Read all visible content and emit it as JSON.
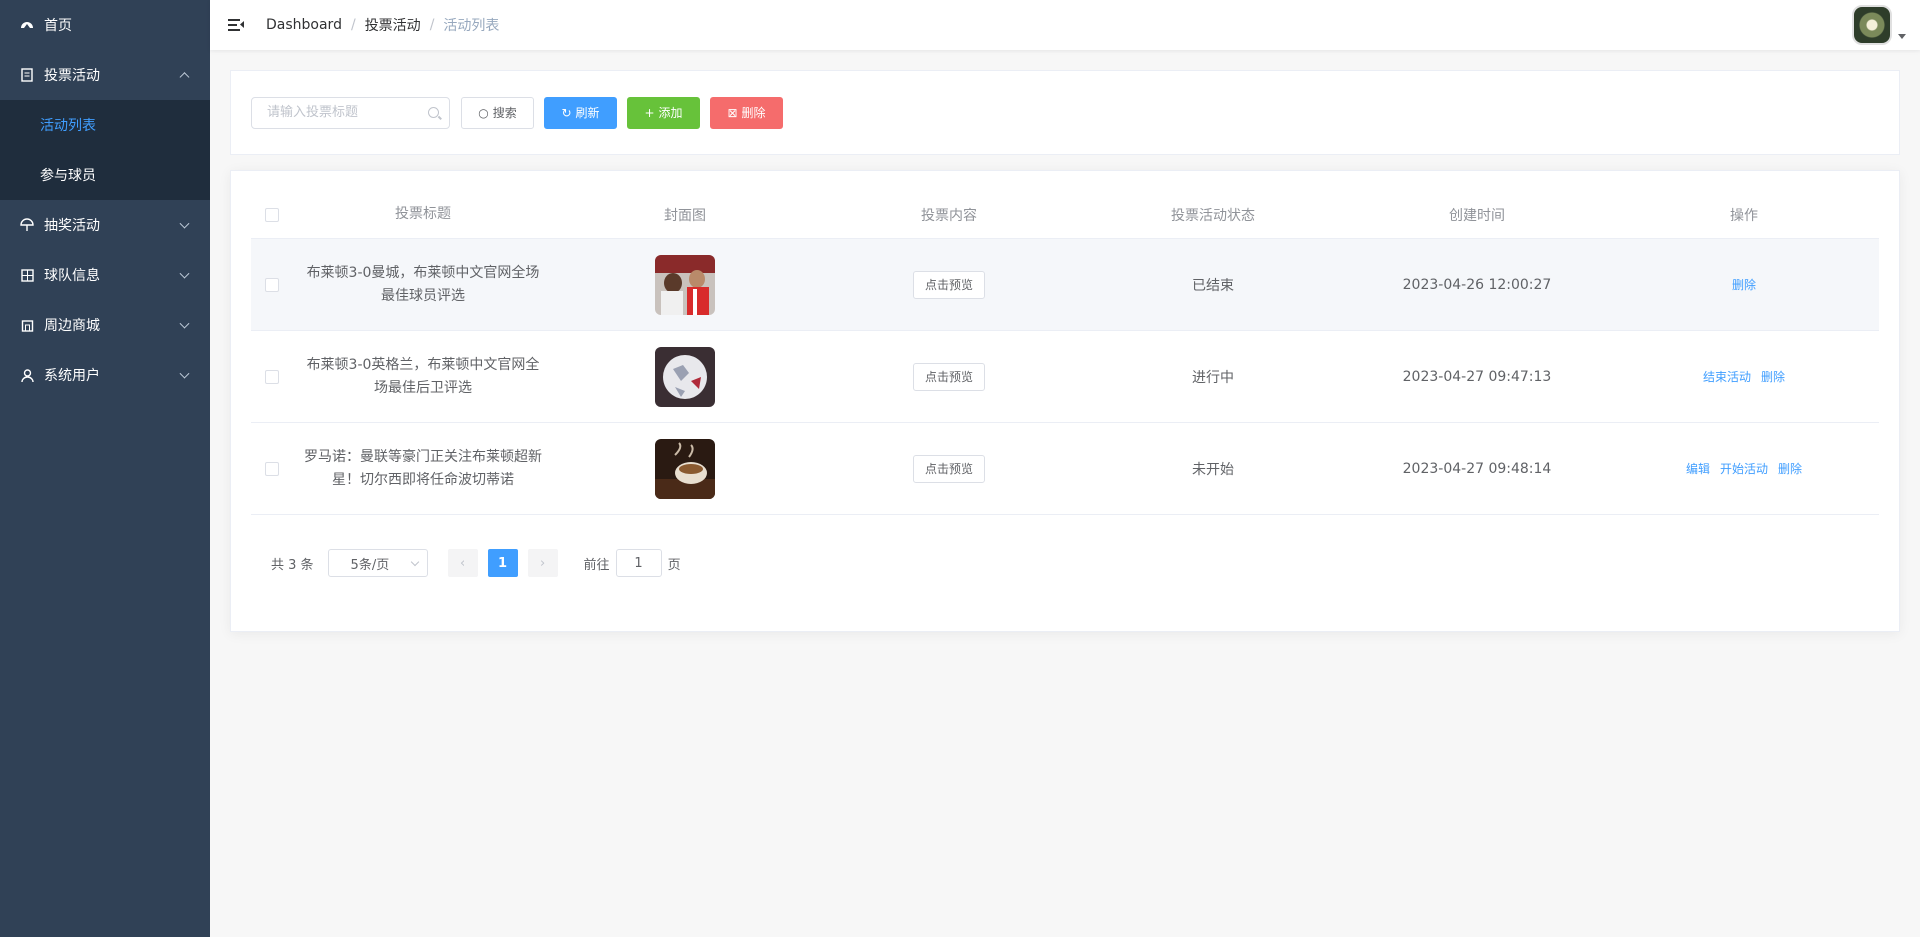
{
  "sidebar": {
    "home_label": "首页",
    "vote_label": "投票活动",
    "vote_sub": [
      "活动列表",
      "参与球员"
    ],
    "lottery_label": "抽奖活动",
    "team_label": "球队信息",
    "mall_label": "周边商城",
    "user_label": "系统用户"
  },
  "breadcrumb": [
    "Dashboard",
    "投票活动",
    "活动列表"
  ],
  "breadcrumb_sep": "/",
  "filter": {
    "search_placeholder": "请输入投票标题",
    "search_label": "搜索",
    "refresh_label": "刷新",
    "add_label": "添加",
    "delete_label": "删除"
  },
  "table": {
    "headers": {
      "title": "投票标题",
      "cover": "封面图",
      "content": "投票内容",
      "status": "投票活动状态",
      "time": "创建时间",
      "ops": "操作"
    },
    "rows": [
      {
        "title": "布莱顿3-0曼城，布莱顿中文官网全场最佳球员评选",
        "cover": "football-players-photo",
        "preview": "点击预览",
        "status": "已结束",
        "time": "2023-04-26 12:00:27",
        "ops": [
          "删除"
        ]
      },
      {
        "title": "布莱顿3-0英格兰，布莱顿中文官网全场最佳后卫评选",
        "cover": "soccer-ball-photo",
        "preview": "点击预览",
        "status": "进行中",
        "time": "2023-04-27 09:47:13",
        "ops": [
          "结束活动",
          "删除"
        ]
      },
      {
        "title": "罗马诺：曼联等豪门正关注布莱顿超新星！切尔西即将任命波切蒂诺",
        "cover": "coffee-cup-photo",
        "preview": "点击预览",
        "status": "未开始",
        "time": "2023-04-27 09:48:14",
        "ops": [
          "编辑",
          "开始活动",
          "删除"
        ]
      }
    ]
  },
  "pagination": {
    "total": "共 3 条",
    "page_size": "5条/页",
    "current_page": "1",
    "goto_label": "前往",
    "goto_value": "1",
    "page_suffix": "页"
  },
  "colors": {
    "sidebar_bg": "#304156",
    "primary": "#409eff",
    "success": "#67c23a",
    "danger": "#f56c6c"
  }
}
